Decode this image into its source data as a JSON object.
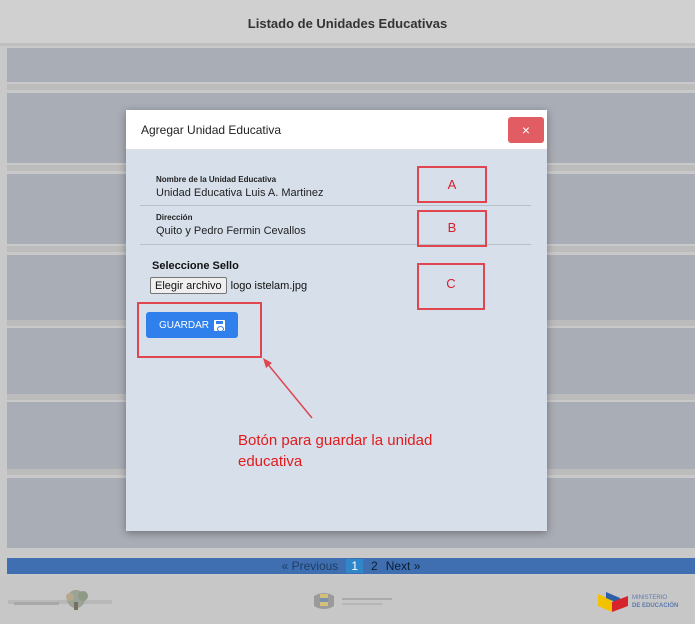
{
  "background": {
    "title": "Listado de Unidades Educativas"
  },
  "pagination": {
    "previous": "« Previous",
    "pages": [
      "1",
      "2"
    ],
    "active_page": "1",
    "next": "Next »"
  },
  "footer": {
    "left_logo": "logo-left",
    "center_logo": "logo-center",
    "right_logo": "ministerio-logo",
    "right_label_1": "MINISTERIO",
    "right_label_2": "DE EDUCACIÓN"
  },
  "modal": {
    "title": "Agregar Unidad Educativa",
    "close_label": "×",
    "fields": [
      {
        "label": "Nombre de la Unidad Educativa",
        "value": "Unidad Educativa Luis A. Martinez"
      },
      {
        "label": "Dirección",
        "value": "Quito y Pedro Fermin Cevallos"
      }
    ],
    "seal_section_title": "Seleccione Sello",
    "file_button_label": "Elegir archivo",
    "file_name": "logo istelam.jpg",
    "save_button_label": "GUARDAR",
    "save_icon": "save-icon"
  },
  "annotations": {
    "box_a": "A",
    "box_b": "B",
    "box_c": "C",
    "note": "Botón para guardar la unidad educativa"
  },
  "colors": {
    "modal_bg": "#d6dfea",
    "primary_button": "#2f80ed",
    "close_button": "#e25c63",
    "annotation_red": "#e31a1c",
    "pagination_bar": "#3f6fb0"
  }
}
